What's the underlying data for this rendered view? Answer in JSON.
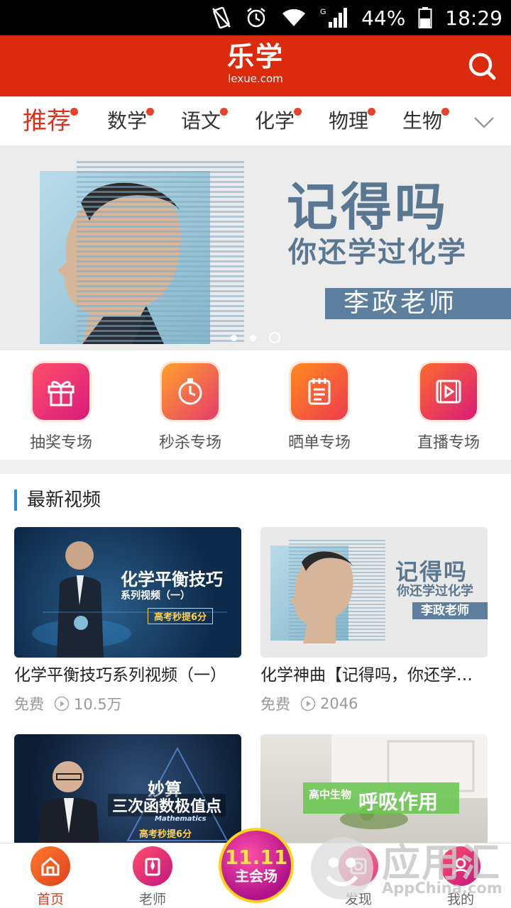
{
  "status_bar": {
    "battery": "44%",
    "time": "18:29",
    "signal_label": "G"
  },
  "header": {
    "logo_main": "乐学",
    "logo_sub": "lexue.com"
  },
  "tabs": [
    {
      "label": "推荐"
    },
    {
      "label": "数学"
    },
    {
      "label": "语文"
    },
    {
      "label": "化学"
    },
    {
      "label": "物理"
    },
    {
      "label": "生物"
    }
  ],
  "banner": {
    "title": "记得吗",
    "subtitle": "你还学过化学",
    "teacher": "李政老师"
  },
  "quick_entries": [
    {
      "label": "抽奖专场",
      "icon": "gift-icon"
    },
    {
      "label": "秒杀专场",
      "icon": "stopwatch-icon"
    },
    {
      "label": "晒单专场",
      "icon": "notepad-icon"
    },
    {
      "label": "直播专场",
      "icon": "video-play-icon"
    }
  ],
  "latest": {
    "section_title": "最新视频",
    "videos": [
      {
        "title": "化学平衡技巧系列视频（一）",
        "price": "免费",
        "views": "10.5万",
        "thumb_title": "化学平衡技巧",
        "thumb_sub": "系列视频（一）",
        "thumb_tag": "高考秒提6分"
      },
      {
        "title": "化学神曲【记得吗，你还学过...",
        "price": "免费",
        "views": "2046",
        "thumb_title": "记得吗",
        "thumb_sub": "你还学过化学",
        "thumb_tag": "李政老师"
      },
      {
        "title": "",
        "price": "",
        "views": "",
        "thumb_title": "妙算",
        "thumb_sub": "三次函数极值点",
        "thumb_tag": "高考秒提6分",
        "thumb_badge": "Mathematics"
      },
      {
        "title": "",
        "price": "",
        "views": "",
        "thumb_title": "呼吸作用",
        "thumb_sub": "高中生物"
      }
    ]
  },
  "bottom_nav": [
    {
      "label": "首页"
    },
    {
      "label": "老师"
    },
    {
      "label": "发现"
    },
    {
      "label": "我的"
    }
  ],
  "promo": {
    "top": "11.11",
    "bottom": "主会场"
  },
  "watermark": {
    "main": "应用汇",
    "sub": "AppChina.com"
  },
  "colors": {
    "brand": "#db2a0e",
    "accent": "#e0401f",
    "section_bar": "#2b8fd8"
  }
}
